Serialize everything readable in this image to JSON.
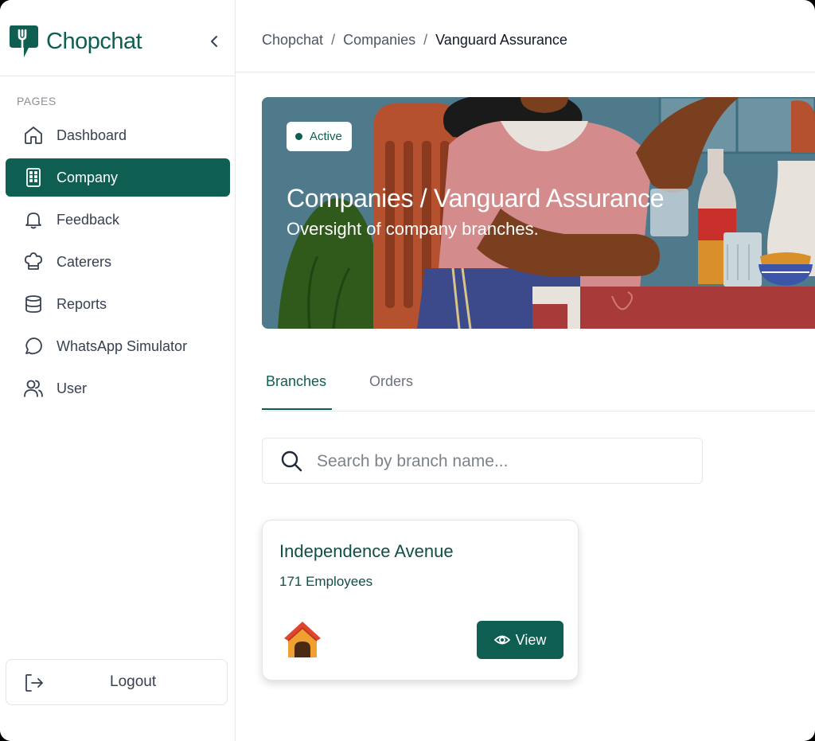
{
  "sidebar": {
    "brand": "Chopchat",
    "section_label": "PAGES",
    "items": [
      {
        "label": "Dashboard",
        "icon": "home-icon"
      },
      {
        "label": "Company",
        "icon": "building-icon",
        "active": true
      },
      {
        "label": "Feedback",
        "icon": "bell-icon"
      },
      {
        "label": "Caterers",
        "icon": "chef-hat-icon"
      },
      {
        "label": "Reports",
        "icon": "database-icon"
      },
      {
        "label": "WhatsApp Simulator",
        "icon": "chat-bubble-icon"
      },
      {
        "label": "User",
        "icon": "users-icon"
      }
    ],
    "logout_label": "Logout"
  },
  "breadcrumb": {
    "items": [
      "Chopchat",
      "Companies",
      "Vanguard Assurance"
    ],
    "separator": "/"
  },
  "hero": {
    "status": "Active",
    "title": "Companies / Vanguard Assurance",
    "subtitle": "Oversight of company branches."
  },
  "tabs": [
    {
      "label": "Branches",
      "active": true
    },
    {
      "label": "Orders",
      "active": false
    }
  ],
  "search": {
    "placeholder": "Search by branch name...",
    "value": ""
  },
  "branches": [
    {
      "name": "Independence Avenue",
      "employees": "171 Employees",
      "icon": "doghouse-icon",
      "action_label": "View"
    }
  ],
  "colors": {
    "brand": "#0f5e52",
    "hero_bg": "#4f7a8c"
  }
}
